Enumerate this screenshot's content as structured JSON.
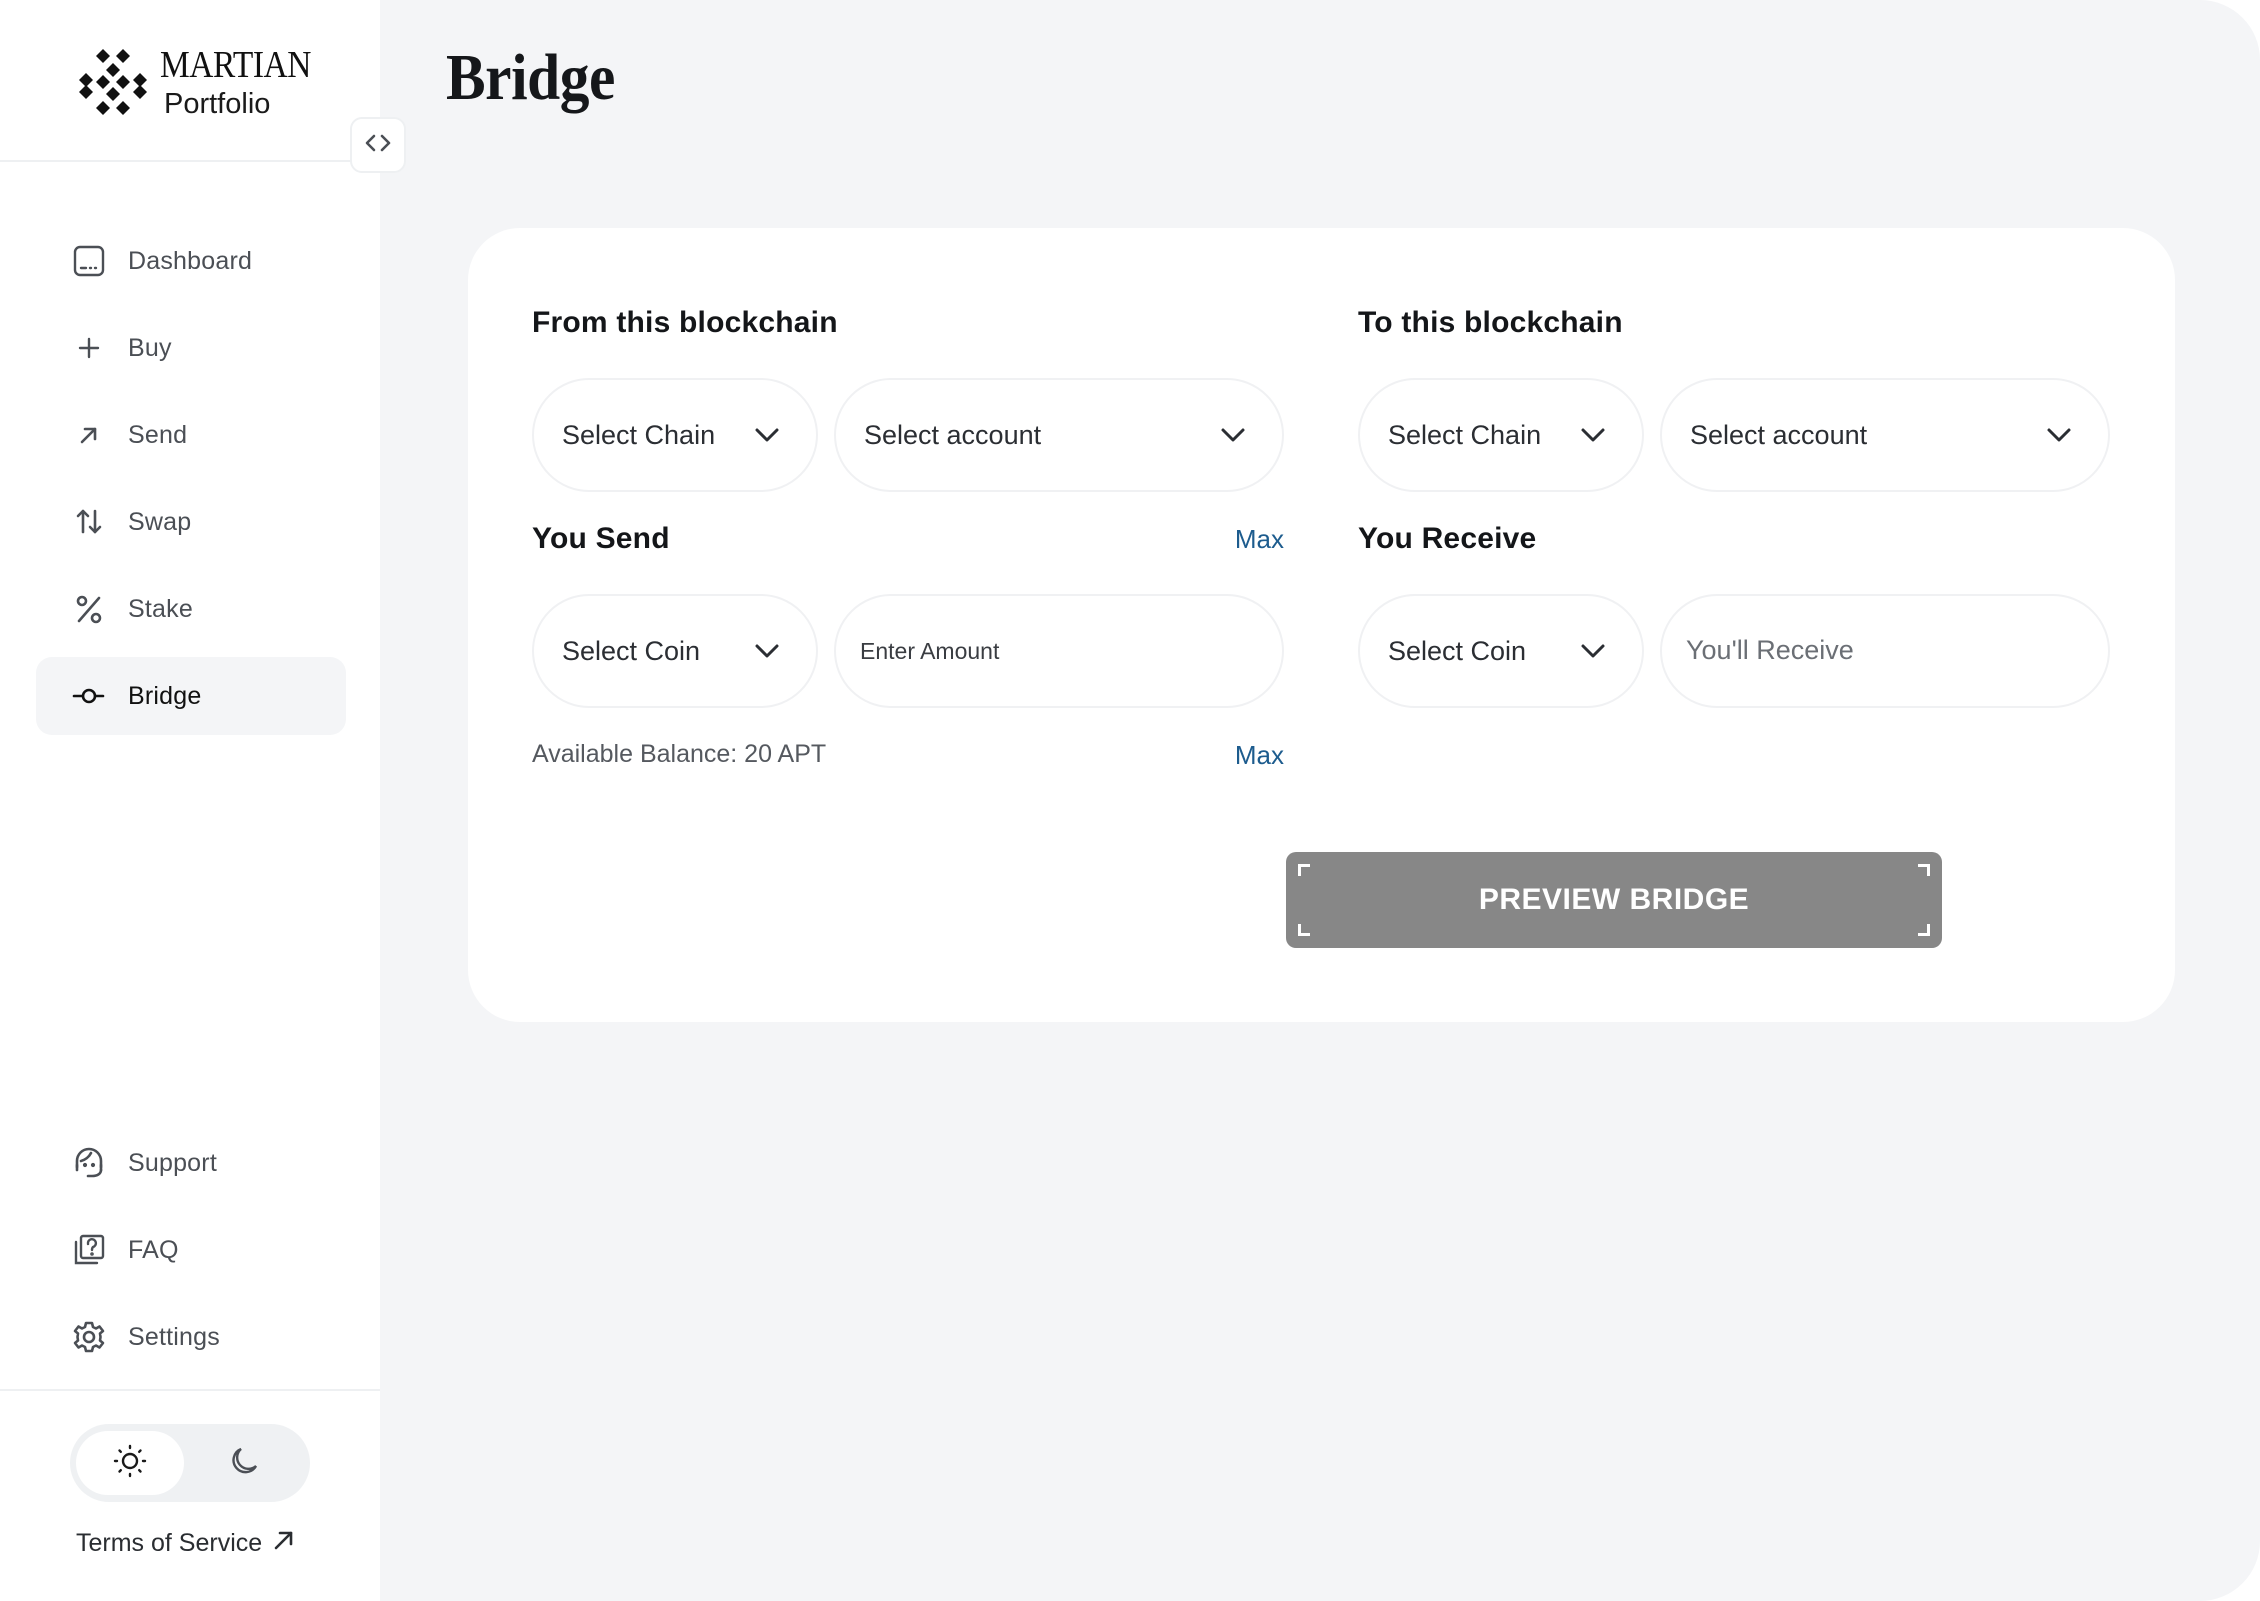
{
  "brand": {
    "name": "MARTIAN",
    "subtitle": "Portfolio",
    "logo_icon": "diamond-lattice-logo"
  },
  "sidebar": {
    "collapse_icon": "code-brackets-icon",
    "items": [
      {
        "label": "Dashboard",
        "icon": "dashboard-icon",
        "active": false
      },
      {
        "label": "Buy",
        "icon": "plus-icon",
        "active": false
      },
      {
        "label": "Send",
        "icon": "arrow-up-right-icon",
        "active": false
      },
      {
        "label": "Swap",
        "icon": "arrows-up-down-icon",
        "active": false
      },
      {
        "label": "Stake",
        "icon": "percent-icon",
        "active": false
      },
      {
        "label": "Bridge",
        "icon": "bridge-node-icon",
        "active": true
      }
    ],
    "bottom_items": [
      {
        "label": "Support",
        "icon": "headset-icon"
      },
      {
        "label": "FAQ",
        "icon": "faq-icon"
      },
      {
        "label": "Settings",
        "icon": "gear-icon"
      }
    ],
    "theme_toggle": {
      "options": [
        {
          "name": "light",
          "icon": "sun-icon",
          "active": true
        },
        {
          "name": "dark",
          "icon": "moon-icon",
          "active": false
        }
      ]
    },
    "terms_label": "Terms of Service",
    "terms_icon": "external-arrow-icon"
  },
  "page": {
    "title": "Bridge"
  },
  "bridge_form": {
    "from": {
      "heading": "From this blockchain",
      "chain_select": "Select Chain",
      "account_select": "Select account"
    },
    "to": {
      "heading": "To this blockchain",
      "chain_select": "Select Chain",
      "account_select": "Select account"
    },
    "send": {
      "heading": "You Send",
      "max_label": "Max",
      "coin_select": "Select Coin",
      "amount_placeholder": "Enter Amount",
      "amount_value": "",
      "balance_text": "Available Balance: 20 APT",
      "balance_max_label": "Max"
    },
    "receive": {
      "heading": "You Receive",
      "coin_select": "Select Coin",
      "receive_placeholder": "You'll Receive",
      "receive_value": ""
    },
    "preview_button": "PREVIEW BRIDGE"
  },
  "colors": {
    "accent_link": "#1d5c8e",
    "button_disabled": "#878787",
    "main_bg": "#f4f5f7",
    "active_nav_bg": "#f4f5f7"
  }
}
